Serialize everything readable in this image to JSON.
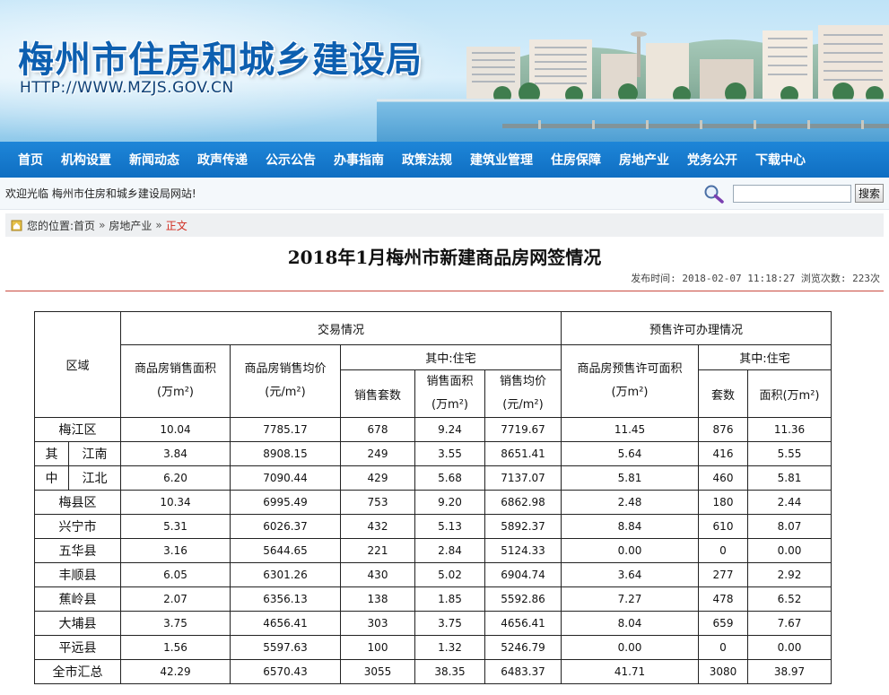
{
  "site": {
    "title": "梅州市住房和城乡建设局",
    "url": "HTTP://WWW.MZJS.GOV.CN"
  },
  "nav": {
    "items": [
      "首页",
      "机构设置",
      "新闻动态",
      "政声传递",
      "公示公告",
      "办事指南",
      "政策法规",
      "建筑业管理",
      "住房保障",
      "房地产业",
      "党务公开",
      "下载中心"
    ]
  },
  "welcome": {
    "text": "欢迎光临 梅州市住房和城乡建设局网站!",
    "search_value": "",
    "search_button": "搜索"
  },
  "breadcrumb": {
    "label": "您的位置:",
    "items": [
      "首页",
      "房地产业",
      "正文"
    ],
    "separator": "»"
  },
  "article": {
    "title": "2018年1月梅州市新建商品房网签情况",
    "meta": "发布时间: 2018-02-07 11:18:27 浏览次数: 223次"
  },
  "table": {
    "headers": {
      "area": "区域",
      "trade": "交易情况",
      "presale": "预售许可办理情况",
      "sales_area": "商品房销售面积",
      "sales_area_unit": "(万m²)",
      "avg_price": "商品房销售均价",
      "avg_price_unit": "(元/m²)",
      "residential": "其中:住宅",
      "sets": "销售套数",
      "res_area": "销售面积",
      "res_area_unit": "(万m²)",
      "res_price": "销售均价",
      "res_price_unit": "(元/m²)",
      "presale_area": "商品房预售许可面积",
      "presale_area_unit": "(万m²)",
      "presale_res": "其中:住宅",
      "presale_sets": "套数",
      "presale_res_area": "面积(万m²)"
    },
    "sub_label_top": "其",
    "sub_label_bottom": "中",
    "rows": [
      {
        "area": "梅江区",
        "v": [
          "10.04",
          "7785.17",
          "678",
          "9.24",
          "7719.67",
          "11.45",
          "876",
          "11.36"
        ]
      },
      {
        "area": "江南",
        "v": [
          "3.84",
          "8908.15",
          "249",
          "3.55",
          "8651.41",
          "5.64",
          "416",
          "5.55"
        ]
      },
      {
        "area": "江北",
        "v": [
          "6.20",
          "7090.44",
          "429",
          "5.68",
          "7137.07",
          "5.81",
          "460",
          "5.81"
        ]
      },
      {
        "area": "梅县区",
        "v": [
          "10.34",
          "6995.49",
          "753",
          "9.20",
          "6862.98",
          "2.48",
          "180",
          "2.44"
        ]
      },
      {
        "area": "兴宁市",
        "v": [
          "5.31",
          "6026.37",
          "432",
          "5.13",
          "5892.37",
          "8.84",
          "610",
          "8.07"
        ]
      },
      {
        "area": "五华县",
        "v": [
          "3.16",
          "5644.65",
          "221",
          "2.84",
          "5124.33",
          "0.00",
          "0",
          "0.00"
        ]
      },
      {
        "area": "丰顺县",
        "v": [
          "6.05",
          "6301.26",
          "430",
          "5.02",
          "6904.74",
          "3.64",
          "277",
          "2.92"
        ]
      },
      {
        "area": "蕉岭县",
        "v": [
          "2.07",
          "6356.13",
          "138",
          "1.85",
          "5592.86",
          "7.27",
          "478",
          "6.52"
        ]
      },
      {
        "area": "大埔县",
        "v": [
          "3.75",
          "4656.41",
          "303",
          "3.75",
          "4656.41",
          "8.04",
          "659",
          "7.67"
        ]
      },
      {
        "area": "平远县",
        "v": [
          "1.56",
          "5597.63",
          "100",
          "1.32",
          "5246.79",
          "0.00",
          "0",
          "0.00"
        ]
      },
      {
        "area": "全市汇总",
        "v": [
          "42.29",
          "6570.43",
          "3055",
          "38.35",
          "6483.37",
          "41.71",
          "3080",
          "38.97"
        ]
      }
    ]
  }
}
